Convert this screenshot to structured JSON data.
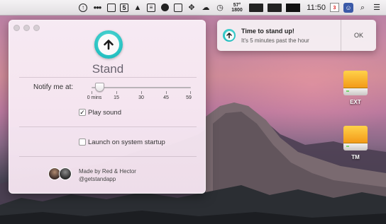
{
  "menubar": {
    "icons": [
      "stand-app-icon",
      "dots-icon",
      "window-icon",
      "html5-icon",
      "hat-icon",
      "text-icon",
      "record-icon",
      "box-icon",
      "dropbox-icon",
      "cloud-icon",
      "history-icon",
      "weather-icon",
      "battery-icon",
      "cpu-icon",
      "screen-icon",
      "calendar-icon",
      "avatar-icon",
      "search-icon",
      "list-icon"
    ],
    "weather_text": "57°\n1800",
    "time": "11:50",
    "calendar_day": "3"
  },
  "panel": {
    "app_title": "Stand",
    "notify_label": "Notify me at:",
    "slider": {
      "value": 5,
      "min": 0,
      "max": 59,
      "tick_labels": [
        "0 mins",
        "15",
        "30",
        "45",
        "59"
      ]
    },
    "play_sound": {
      "label": "Play sound",
      "checked": true,
      "check_glyph": "✓"
    },
    "launch_startup": {
      "label": "Launch on system startup",
      "checked": false,
      "check_glyph": ""
    },
    "credits": {
      "line1": "Made by Red & Hector",
      "line2": "@getstandapp"
    }
  },
  "notification": {
    "title": "Time to stand up!",
    "body": "It's 5 minutes past the hour",
    "ok_label": "OK"
  },
  "drives": [
    {
      "label": "EXT"
    },
    {
      "label": "TM"
    }
  ],
  "colors": {
    "accent_teal": "#22bfc0",
    "drive_orange": "#f39a18"
  }
}
